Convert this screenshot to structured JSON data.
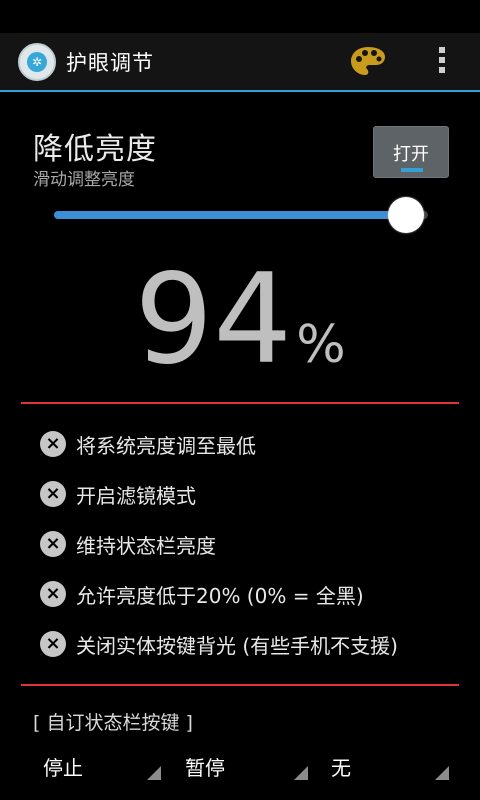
{
  "app": {
    "title": "护眼调节"
  },
  "brightness": {
    "title": "降低亮度",
    "subtitle": "滑动调整亮度",
    "toggle_label": "打开",
    "slider_value_fraction": 0.94,
    "value": "94",
    "unit": "%"
  },
  "options": [
    {
      "label": "将系统亮度调至最低"
    },
    {
      "label": "开启滤镜模式"
    },
    {
      "label": "维持状态栏亮度"
    },
    {
      "label": "允许亮度低于20% (0% = 全黑)"
    },
    {
      "label": "关闭实体按键背光 (有些手机不支援)"
    }
  ],
  "custom_keys": {
    "title": "[ 自订状态栏按键 ]",
    "dropdowns": [
      {
        "value": "停止"
      },
      {
        "value": "暂停"
      },
      {
        "value": "无"
      }
    ]
  },
  "colors": {
    "accent": "#33a0d6",
    "divider": "#e0313b",
    "slider": "#3d8fd5"
  },
  "icons": {
    "app": "app-eye-icon",
    "theme": "palette-icon",
    "overflow": "overflow-menu-icon",
    "option": "close-circle-icon"
  }
}
